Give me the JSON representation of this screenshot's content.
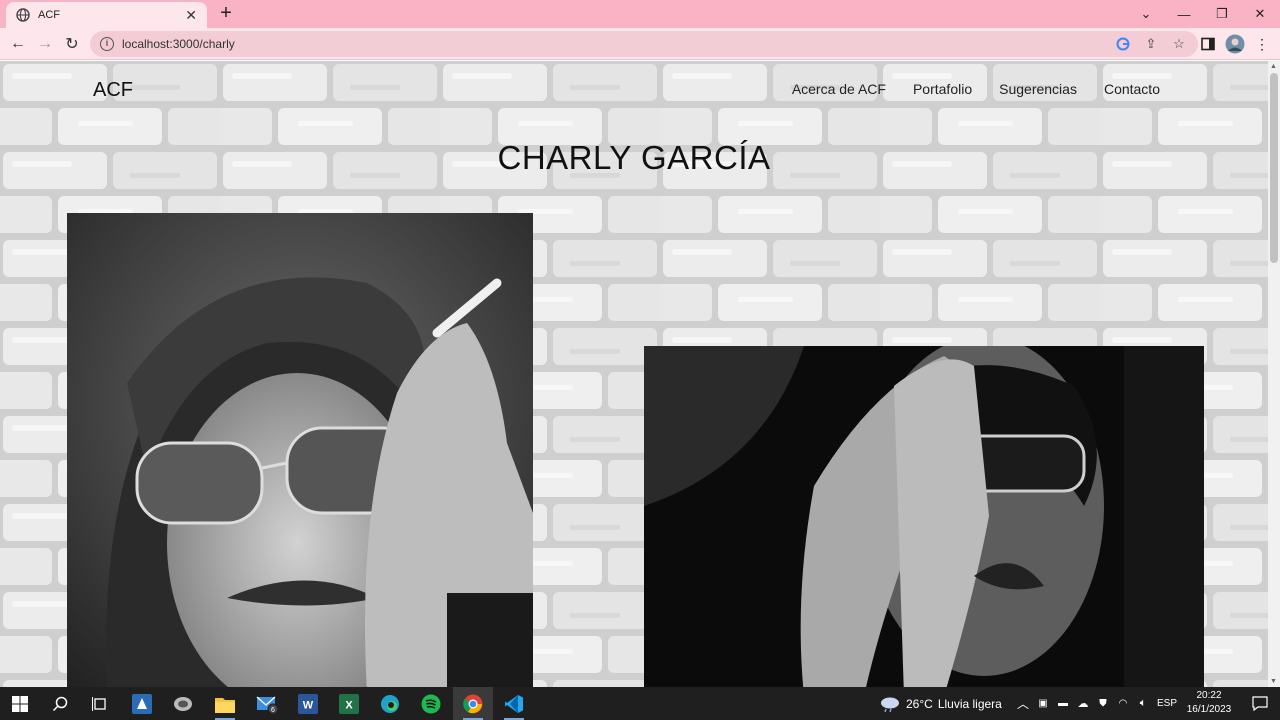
{
  "browser": {
    "tab_title": "ACF",
    "url": "localhost:3000/charly",
    "icons": [
      "globe-icon",
      "close-icon",
      "plus-icon",
      "chevron-down-icon",
      "minimize-icon",
      "restore-icon",
      "close-icon",
      "back-icon",
      "forward-icon",
      "reload-icon",
      "info-icon",
      "google-icon",
      "share-icon",
      "star-icon",
      "sidepanel-icon",
      "avatar",
      "menu-icon"
    ]
  },
  "site": {
    "logo": "ACF",
    "nav": [
      "Acerca de ACF",
      "Portafolio",
      "Sugerencias",
      "Contacto"
    ],
    "title": "CHARLY GARCÍA"
  },
  "taskbar": {
    "apps": [
      "windows-start-icon",
      "search-icon",
      "task-view-icon",
      "app-icon",
      "app-icon",
      "file-explorer-icon",
      "mail-icon",
      "word-icon",
      "excel-icon",
      "edge-icon",
      "spotify-icon",
      "chrome-icon",
      "vscode-icon"
    ],
    "mail_badge": "6",
    "weather_temp": "26°C",
    "weather_text": "Lluvia ligera",
    "language": "ESP",
    "time": "20:22",
    "date": "16/1/2023"
  }
}
